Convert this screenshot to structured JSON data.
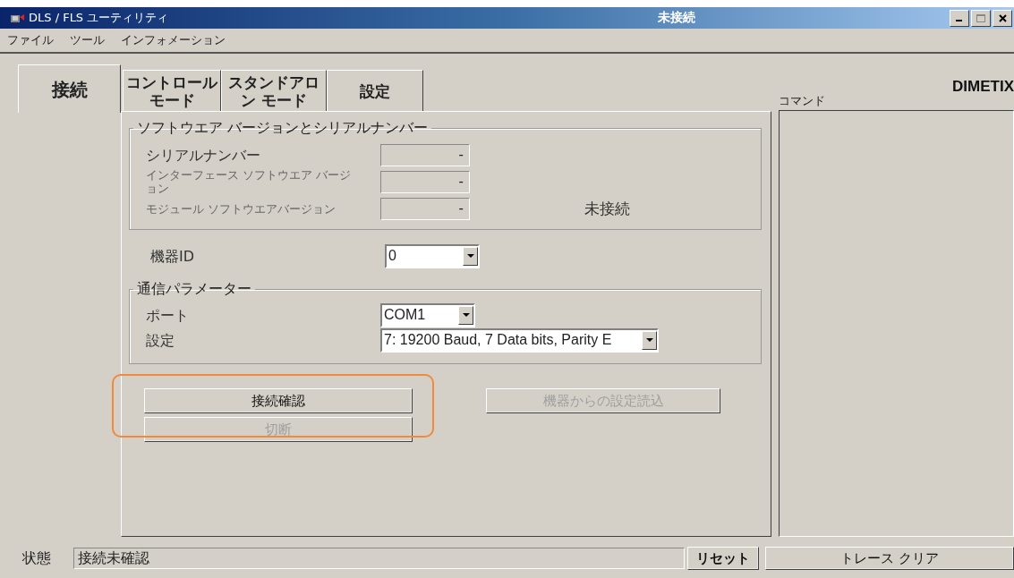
{
  "window": {
    "title": "DLS / FLS ユーティリティ",
    "status_title": "未接続"
  },
  "menu": [
    "ファイル",
    "ツール",
    "インフォメーション"
  ],
  "tabs": [
    {
      "lines": [
        "接続"
      ],
      "selected": true
    },
    {
      "lines": [
        "コントロール",
        "モード"
      ],
      "selected": false
    },
    {
      "lines": [
        "スタンドアロ",
        "ン モード"
      ],
      "selected": false
    },
    {
      "lines": [
        "設定"
      ],
      "selected": false
    }
  ],
  "software_group": {
    "title": "ソフトウエア バージョンとシリアルナンバー",
    "rows": [
      {
        "label": "シリアルナンバー",
        "value": "-",
        "disabled": false
      },
      {
        "label": "インターフェース ソフトウエア バージョン",
        "value": "-",
        "disabled": true
      },
      {
        "label": "モジュール ソフトウエアバージョン",
        "value": "-",
        "disabled": true
      }
    ],
    "connection_status": "未接続"
  },
  "device_id": {
    "label": "機器ID",
    "value": "0"
  },
  "comm_group": {
    "title": "通信パラメーター",
    "rows": [
      {
        "label": "ポート",
        "value": "COM1",
        "kind": "narrow"
      },
      {
        "label": "設定",
        "value": "7: 19200 Baud, 7 Data bits, Parity E",
        "kind": "wide"
      }
    ]
  },
  "buttons": [
    {
      "label": "接続確認",
      "disabled": false
    },
    {
      "label": "切断",
      "disabled": true
    },
    {
      "label": "機器からの設定読込",
      "disabled": true
    }
  ],
  "highlight": {
    "shown": true
  },
  "command_panel": {
    "label": "コマンド",
    "logo": "DIMETIX"
  },
  "status_bar": {
    "label": "状態",
    "value": "接続未確認",
    "reset_button": "リセット",
    "clear_button": "トレース クリア"
  }
}
